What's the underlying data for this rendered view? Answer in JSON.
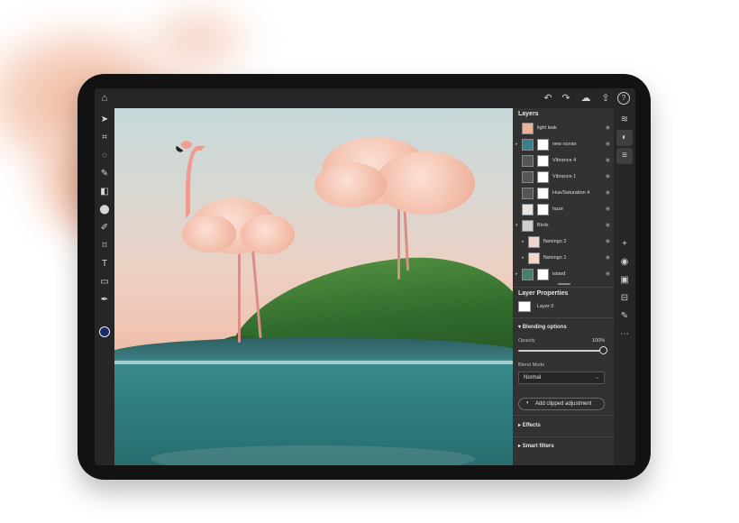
{
  "panel": {
    "layers_title": "Layers",
    "layers": [
      {
        "name": "light leak",
        "thumb_color": "#e7b49a",
        "has_mask": false,
        "indent": 0,
        "expander": ""
      },
      {
        "name": "new ocean",
        "thumb_color": "#3d7f86",
        "has_mask": true,
        "indent": 0,
        "expander": "▸"
      },
      {
        "name": "Vibrance 4",
        "thumb_color": "#555555",
        "has_mask": true,
        "indent": 0,
        "expander": ""
      },
      {
        "name": "Vibrance 1",
        "thumb_color": "#555555",
        "has_mask": true,
        "indent": 0,
        "expander": ""
      },
      {
        "name": "Hue/Saturation 4",
        "thumb_color": "#555555",
        "has_mask": true,
        "indent": 0,
        "expander": ""
      },
      {
        "name": "haze",
        "thumb_color": "#e8e3df",
        "has_mask": true,
        "indent": 0,
        "expander": ""
      },
      {
        "name": "Birds",
        "thumb_color": "#cfcfcf",
        "has_mask": false,
        "indent": 0,
        "expander": "▾"
      },
      {
        "name": "flamingo 2",
        "thumb_color": "#f2d6cc",
        "has_mask": false,
        "indent": 1,
        "expander": "▸"
      },
      {
        "name": "flamingo 1",
        "thumb_color": "#f2d6cc",
        "has_mask": false,
        "indent": 1,
        "expander": "▸"
      },
      {
        "name": "island",
        "thumb_color": "#4a7d6a",
        "has_mask": true,
        "indent": 0,
        "expander": "▸"
      }
    ],
    "layer_properties_title": "Layer Properties",
    "layer_name": "Layer 0",
    "blending_title": "Blending options",
    "opacity_label": "Opacity",
    "opacity_value": "100%",
    "opacity_fraction": 1.0,
    "blend_mode_label": "Blend Mode",
    "blend_mode_value": "Normal",
    "add_clipped_label": "Add clipped adjustment",
    "effects_label": "Effects",
    "smart_filters_label": "Smart filters"
  },
  "icons": {
    "home": "⌂",
    "undo": "↶",
    "redo": "↷",
    "cloud": "☁",
    "share": "⇪",
    "help": "?",
    "tools": [
      "➤",
      "⌗",
      "◌",
      "✎",
      "◧",
      "⬤",
      "✐",
      "⌑",
      "T",
      "▭",
      "✒"
    ],
    "strip": [
      "≋",
      "◐",
      "≡",
      "+",
      "◉",
      "▣",
      "⊟",
      "✎",
      "⋯"
    ]
  },
  "colors": {
    "foreground_swatch": "#1b2a6b",
    "panel_bg": "#323232",
    "toolbar_bg": "#262626"
  }
}
